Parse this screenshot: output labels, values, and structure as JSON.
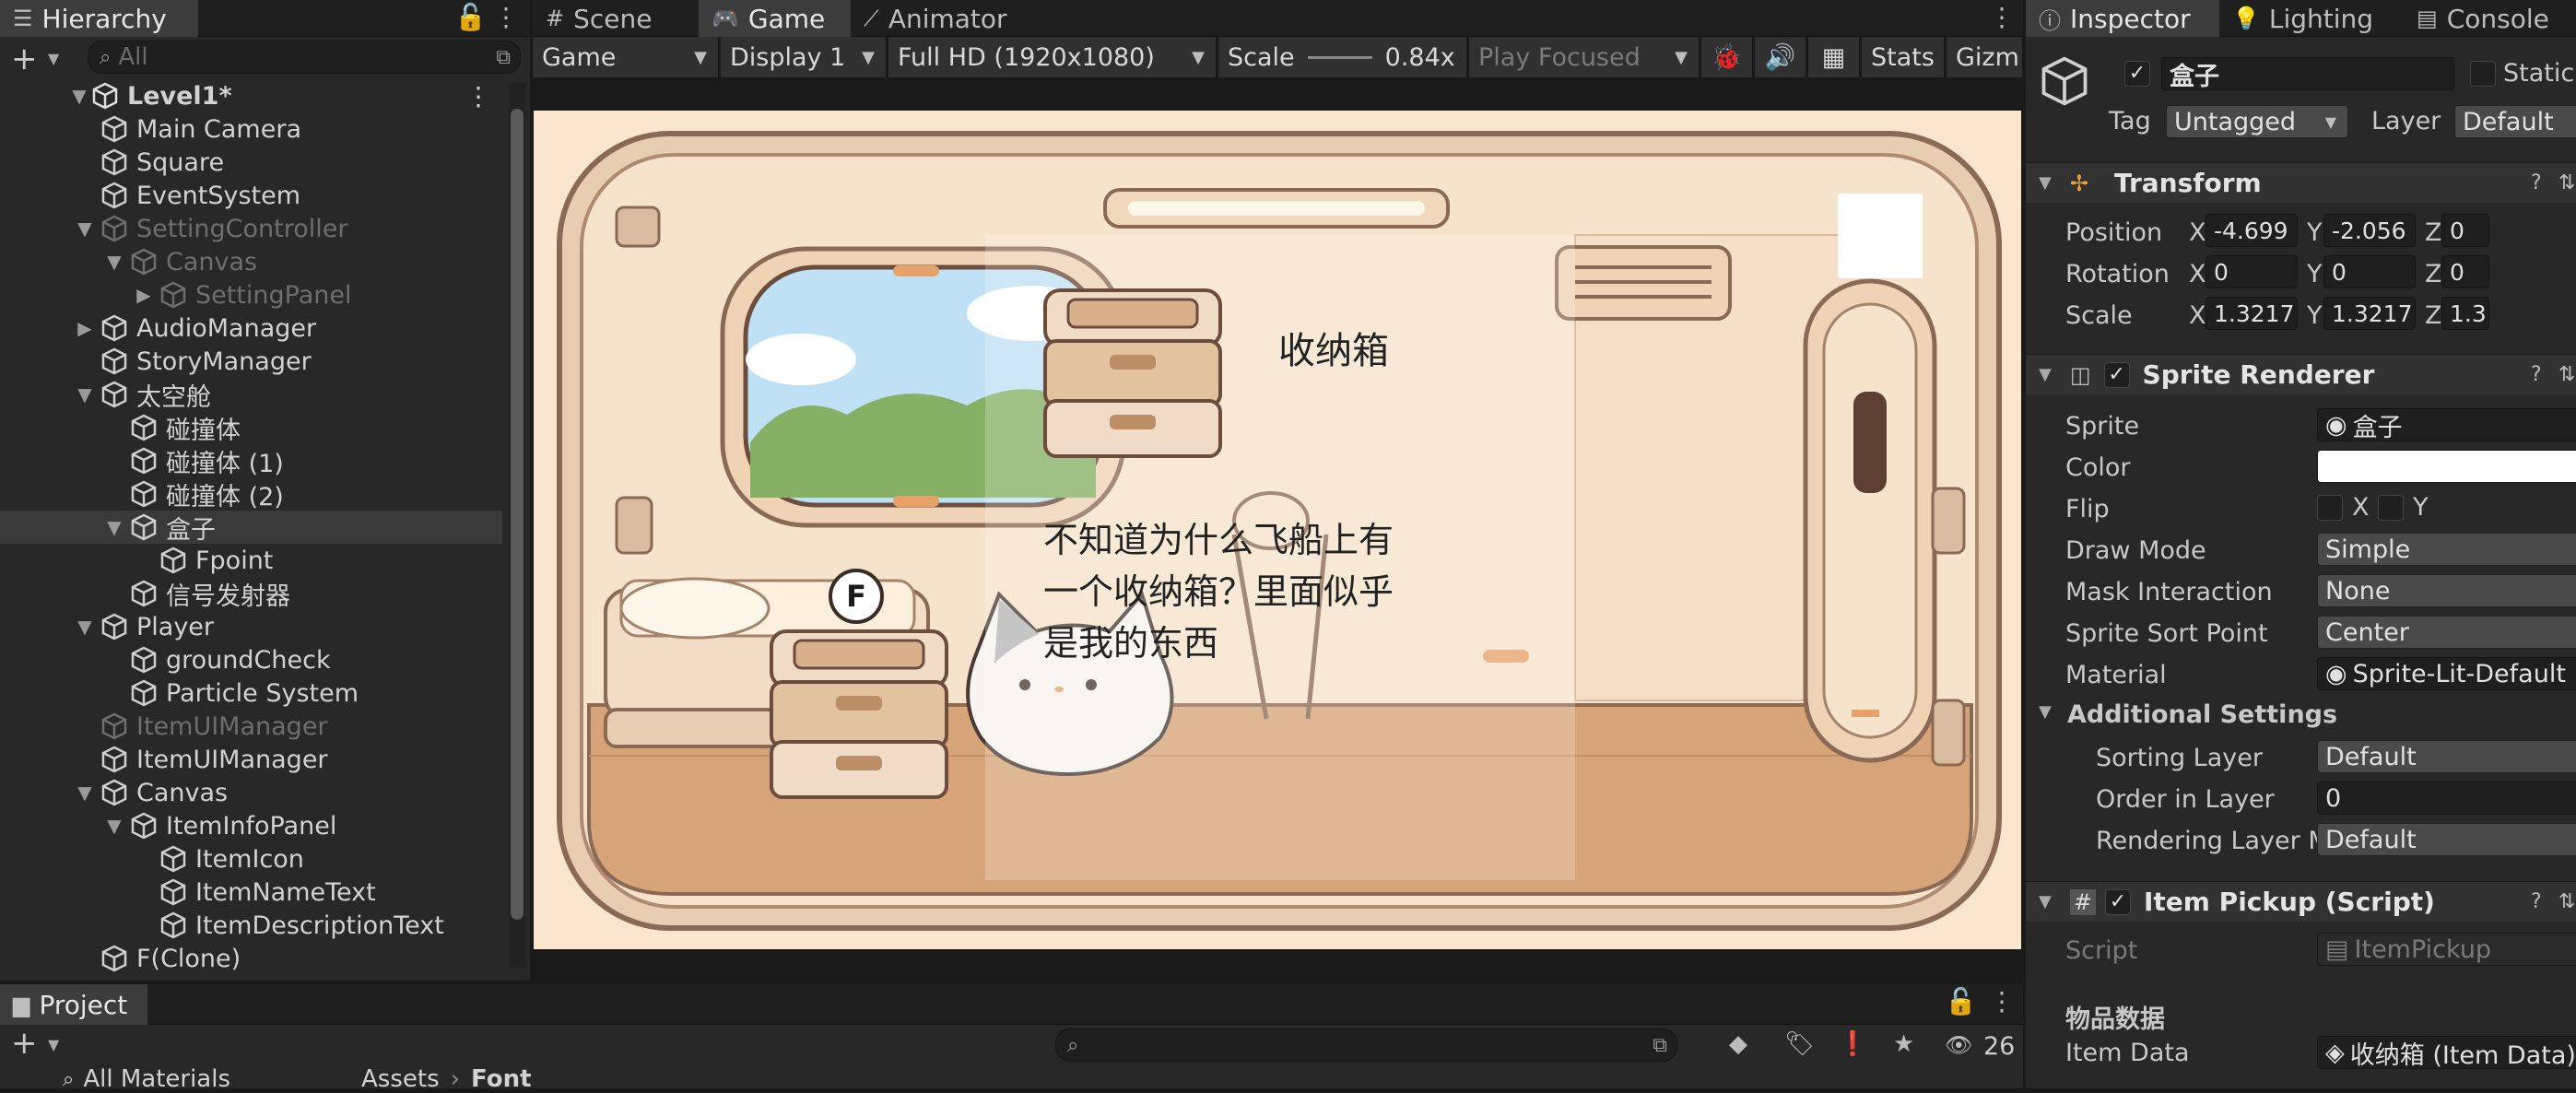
{
  "hierarchy": {
    "tab": "Hierarchy",
    "search_placeholder": "All",
    "scene": "Level1*",
    "items": [
      {
        "label": "Main Camera",
        "indent": 1,
        "arrow": "",
        "dim": false
      },
      {
        "label": "Square",
        "indent": 1,
        "arrow": "",
        "dim": false
      },
      {
        "label": "EventSystem",
        "indent": 1,
        "arrow": "",
        "dim": false
      },
      {
        "label": "SettingController",
        "indent": 1,
        "arrow": "▼",
        "dim": true
      },
      {
        "label": "Canvas",
        "indent": 2,
        "arrow": "▼",
        "dim": true
      },
      {
        "label": "SettingPanel",
        "indent": 3,
        "arrow": "▶",
        "dim": true
      },
      {
        "label": "AudioManager",
        "indent": 1,
        "arrow": "▶",
        "dim": false
      },
      {
        "label": "StoryManager",
        "indent": 1,
        "arrow": "",
        "dim": false
      },
      {
        "label": "太空舱",
        "indent": 1,
        "arrow": "▼",
        "dim": false
      },
      {
        "label": "碰撞体",
        "indent": 2,
        "arrow": "",
        "dim": false
      },
      {
        "label": "碰撞体 (1)",
        "indent": 2,
        "arrow": "",
        "dim": false
      },
      {
        "label": "碰撞体 (2)",
        "indent": 2,
        "arrow": "",
        "dim": false
      },
      {
        "label": "盒子",
        "indent": 2,
        "arrow": "▼",
        "dim": false,
        "selected": true
      },
      {
        "label": "Fpoint",
        "indent": 3,
        "arrow": "",
        "dim": false
      },
      {
        "label": "信号发射器",
        "indent": 2,
        "arrow": "",
        "dim": false
      },
      {
        "label": "Player",
        "indent": 1,
        "arrow": "▼",
        "dim": false
      },
      {
        "label": "groundCheck",
        "indent": 2,
        "arrow": "",
        "dim": false
      },
      {
        "label": "Particle System",
        "indent": 2,
        "arrow": "",
        "dim": false
      },
      {
        "label": "ItemUIManager",
        "indent": 1,
        "arrow": "",
        "dim": true
      },
      {
        "label": "ItemUIManager",
        "indent": 1,
        "arrow": "",
        "dim": false
      },
      {
        "label": "Canvas",
        "indent": 1,
        "arrow": "▼",
        "dim": false
      },
      {
        "label": "ItemInfoPanel",
        "indent": 2,
        "arrow": "▼",
        "dim": false
      },
      {
        "label": "ItemIcon",
        "indent": 3,
        "arrow": "",
        "dim": false
      },
      {
        "label": "ItemNameText",
        "indent": 3,
        "arrow": "",
        "dim": false
      },
      {
        "label": "ItemDescriptionText",
        "indent": 3,
        "arrow": "",
        "dim": false
      },
      {
        "label": "F(Clone)",
        "indent": 1,
        "arrow": "",
        "dim": false
      }
    ]
  },
  "game_view": {
    "tabs": [
      "Scene",
      "Game",
      "Animator"
    ],
    "toolbar": {
      "mode": "Game",
      "display": "Display 1",
      "resolution": "Full HD (1920x1080)",
      "scale_label": "Scale",
      "scale_value": "0.84x",
      "play_mode": "Play Focused",
      "stats": "Stats",
      "gizmos": "Gizm"
    },
    "item_panel": {
      "name": "收纳箱",
      "description_lines": [
        "不知道为什么飞船上有",
        "一个收纳箱？里面似乎",
        "是我的东西"
      ]
    },
    "interact_key": "F"
  },
  "inspector": {
    "tabs": [
      "Inspector",
      "Lighting",
      "Console"
    ],
    "object_name": "盒子",
    "static_label": "Static",
    "tag_label": "Tag",
    "tag_value": "Untagged",
    "layer_label": "Layer",
    "layer_value": "Default",
    "transform": {
      "title": "Transform",
      "position_label": "Position",
      "rotation_label": "Rotation",
      "scale_label": "Scale",
      "position": {
        "x": "-4.699",
        "y": "-2.056",
        "z": "0"
      },
      "rotation": {
        "x": "0",
        "y": "0",
        "z": "0"
      },
      "scale": {
        "x": "1.3217",
        "y": "1.3217",
        "z": "1.3"
      }
    },
    "sprite_renderer": {
      "title": "Sprite Renderer",
      "rows": [
        {
          "label": "Sprite",
          "value": "盒子",
          "kind": "field"
        },
        {
          "label": "Color",
          "value": "",
          "kind": "color"
        },
        {
          "label": "Flip",
          "value": "",
          "kind": "flip"
        },
        {
          "label": "Draw Mode",
          "value": "Simple",
          "kind": "drop"
        },
        {
          "label": "Mask Interaction",
          "value": "None",
          "kind": "drop"
        },
        {
          "label": "Sprite Sort Point",
          "value": "Center",
          "kind": "drop"
        },
        {
          "label": "Material",
          "value": "Sprite-Lit-Default",
          "kind": "field"
        }
      ],
      "additional_title": "Additional Settings",
      "additional_rows": [
        {
          "label": "Sorting Layer",
          "value": "Default",
          "kind": "drop"
        },
        {
          "label": "Order in Layer",
          "value": "0",
          "kind": "field"
        },
        {
          "label": "Rendering Layer M",
          "value": "Default",
          "kind": "drop"
        }
      ]
    },
    "item_pickup": {
      "title": "Item Pickup (Script)",
      "script_label": "Script",
      "script_value": "ItemPickup",
      "section": "物品数据",
      "item_data_label": "Item Data",
      "item_data_value": "收纳箱 (Item Data)"
    }
  },
  "project": {
    "tab": "Project",
    "count": "26",
    "favorite": "All Materials",
    "breadcrumb": [
      "Assets",
      "Font"
    ]
  },
  "colors": {
    "accent": "#4c7fff",
    "panel": "#282828",
    "selected": "#3a3a3a"
  }
}
